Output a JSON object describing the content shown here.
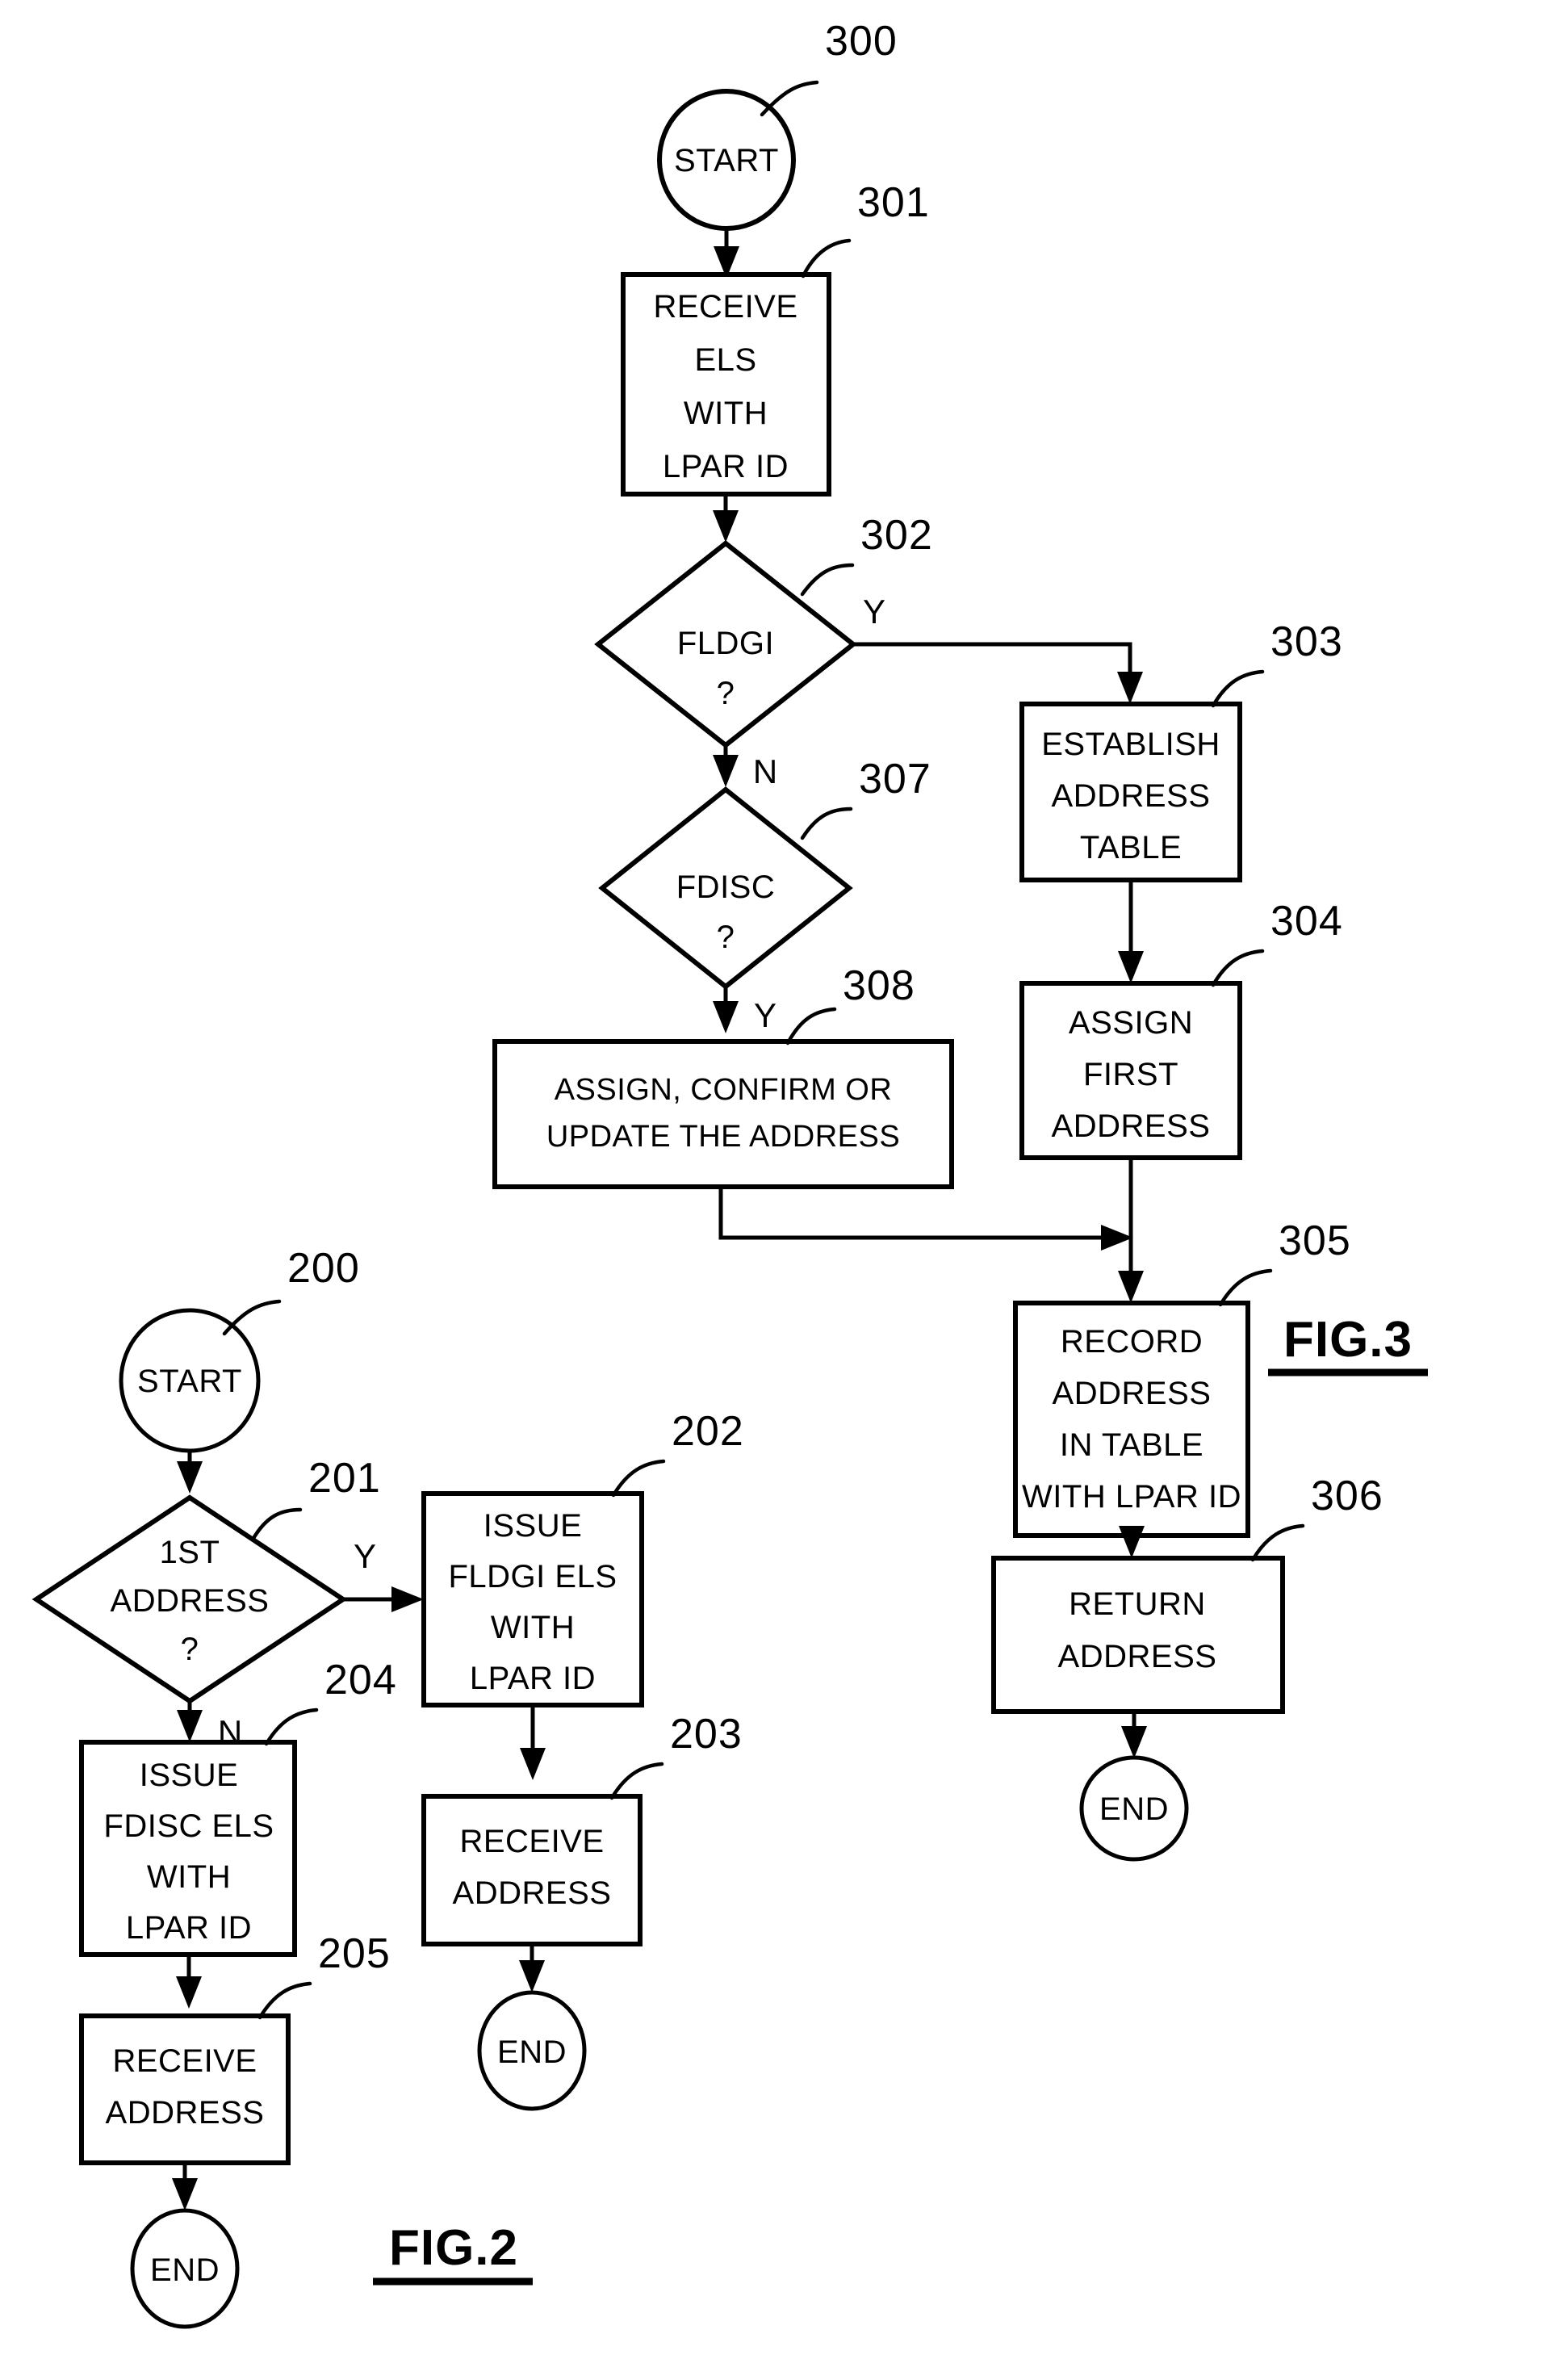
{
  "figures": [
    {
      "id": "fig3",
      "label": "FIG.3",
      "nodes": [
        {
          "ref": "300",
          "type": "terminator",
          "text": "START",
          "lines": [
            "START"
          ]
        },
        {
          "ref": "301",
          "type": "process",
          "text": "RECEIVE ELS WITH LPAR ID",
          "lines": [
            "RECEIVE",
            "ELS",
            "WITH",
            "LPAR  ID"
          ]
        },
        {
          "ref": "302",
          "type": "decision",
          "text": "FLDGI ?",
          "lines": [
            "FLDGI",
            "?"
          ]
        },
        {
          "ref": "307",
          "type": "decision",
          "text": "FDISC ?",
          "lines": [
            "FDISC",
            "?"
          ]
        },
        {
          "ref": "308",
          "type": "process",
          "text": "ASSIGN, CONFIRM OR UPDATE THE ADDRESS",
          "lines": [
            "ASSIGN,  CONFIRM  OR",
            "UPDATE  THE  ADDRESS"
          ]
        },
        {
          "ref": "303",
          "type": "process",
          "text": "ESTABLISH ADDRESS TABLE",
          "lines": [
            "ESTABLISH",
            "ADDRESS",
            "TABLE"
          ]
        },
        {
          "ref": "304",
          "type": "process",
          "text": "ASSIGN FIRST ADDRESS",
          "lines": [
            "ASSIGN",
            "FIRST",
            "ADDRESS"
          ]
        },
        {
          "ref": "305",
          "type": "process",
          "text": "RECORD ADDRESS IN TABLE WITH LPAR ID",
          "lines": [
            "RECORD",
            "ADDRESS",
            "IN  TABLE",
            "WITH  LPAR  ID"
          ]
        },
        {
          "ref": "306",
          "type": "process",
          "text": "RETURN ADDRESS",
          "lines": [
            "RETURN",
            "ADDRESS"
          ]
        },
        {
          "ref": "",
          "type": "terminator",
          "text": "END",
          "lines": [
            "END"
          ]
        }
      ],
      "branch_labels": {
        "fldgi_yes": "Y",
        "fldgi_no": "N",
        "fdisc_yes": "Y"
      }
    },
    {
      "id": "fig2",
      "label": "FIG.2",
      "nodes": [
        {
          "ref": "200",
          "type": "terminator",
          "text": "START",
          "lines": [
            "START"
          ]
        },
        {
          "ref": "201",
          "type": "decision",
          "text": "1ST ADDRESS ?",
          "lines": [
            "1ST",
            "ADDRESS",
            "?"
          ]
        },
        {
          "ref": "202",
          "type": "process",
          "text": "ISSUE FLDGI ELS WITH LPAR ID",
          "lines": [
            "ISSUE",
            "FLDGI  ELS",
            "WITH",
            "LPAR  ID"
          ]
        },
        {
          "ref": "203",
          "type": "process",
          "text": "RECEIVE ADDRESS",
          "lines": [
            "RECEIVE",
            "ADDRESS"
          ]
        },
        {
          "ref": "204",
          "type": "process",
          "text": "ISSUE FDISC ELS WITH LPAR ID",
          "lines": [
            "ISSUE",
            "FDISC  ELS",
            "WITH",
            "LPAR  ID"
          ]
        },
        {
          "ref": "205",
          "type": "process",
          "text": "RECEIVE ADDRESS",
          "lines": [
            "RECEIVE",
            "ADDRESS"
          ]
        },
        {
          "ref": "",
          "type": "terminator",
          "text": "END",
          "lines": [
            "END"
          ]
        }
      ],
      "branch_labels": {
        "first_yes": "Y",
        "first_no": "N"
      }
    }
  ],
  "fig3": {
    "label": "FIG.3",
    "n300": {
      "ref": "300",
      "l1": "START"
    },
    "n301": {
      "ref": "301",
      "l1": "RECEIVE",
      "l2": "ELS",
      "l3": "WITH",
      "l4": "LPAR  ID"
    },
    "n302": {
      "ref": "302",
      "l1": "FLDGI",
      "l2": "?",
      "yes": "Y",
      "no": "N"
    },
    "n307": {
      "ref": "307",
      "l1": "FDISC",
      "l2": "?",
      "yes": "Y"
    },
    "n308": {
      "ref": "308",
      "l1": "ASSIGN,  CONFIRM  OR",
      "l2": "UPDATE  THE  ADDRESS"
    },
    "n303": {
      "ref": "303",
      "l1": "ESTABLISH",
      "l2": "ADDRESS",
      "l3": "TABLE"
    },
    "n304": {
      "ref": "304",
      "l1": "ASSIGN",
      "l2": "FIRST",
      "l3": "ADDRESS"
    },
    "n305": {
      "ref": "305",
      "l1": "RECORD",
      "l2": "ADDRESS",
      "l3": "IN  TABLE",
      "l4": "WITH  LPAR  ID"
    },
    "n306": {
      "ref": "306",
      "l1": "RETURN",
      "l2": "ADDRESS"
    },
    "nend": {
      "l1": "END"
    }
  },
  "fig2": {
    "label": "FIG.2",
    "n200": {
      "ref": "200",
      "l1": "START"
    },
    "n201": {
      "ref": "201",
      "l1": "1ST",
      "l2": "ADDRESS",
      "l3": "?",
      "yes": "Y",
      "no": "N"
    },
    "n202": {
      "ref": "202",
      "l1": "ISSUE",
      "l2": "FLDGI  ELS",
      "l3": "WITH",
      "l4": "LPAR  ID"
    },
    "n203": {
      "ref": "203",
      "l1": "RECEIVE",
      "l2": "ADDRESS"
    },
    "n204": {
      "ref": "204",
      "l1": "ISSUE",
      "l2": "FDISC  ELS",
      "l3": "WITH",
      "l4": "LPAR  ID"
    },
    "n205": {
      "ref": "205",
      "l1": "RECEIVE",
      "l2": "ADDRESS"
    },
    "nend1": {
      "l1": "END"
    },
    "nend2": {
      "l1": "END"
    }
  },
  "colors": {
    "ink": "#000000",
    "paper": "#ffffff"
  }
}
